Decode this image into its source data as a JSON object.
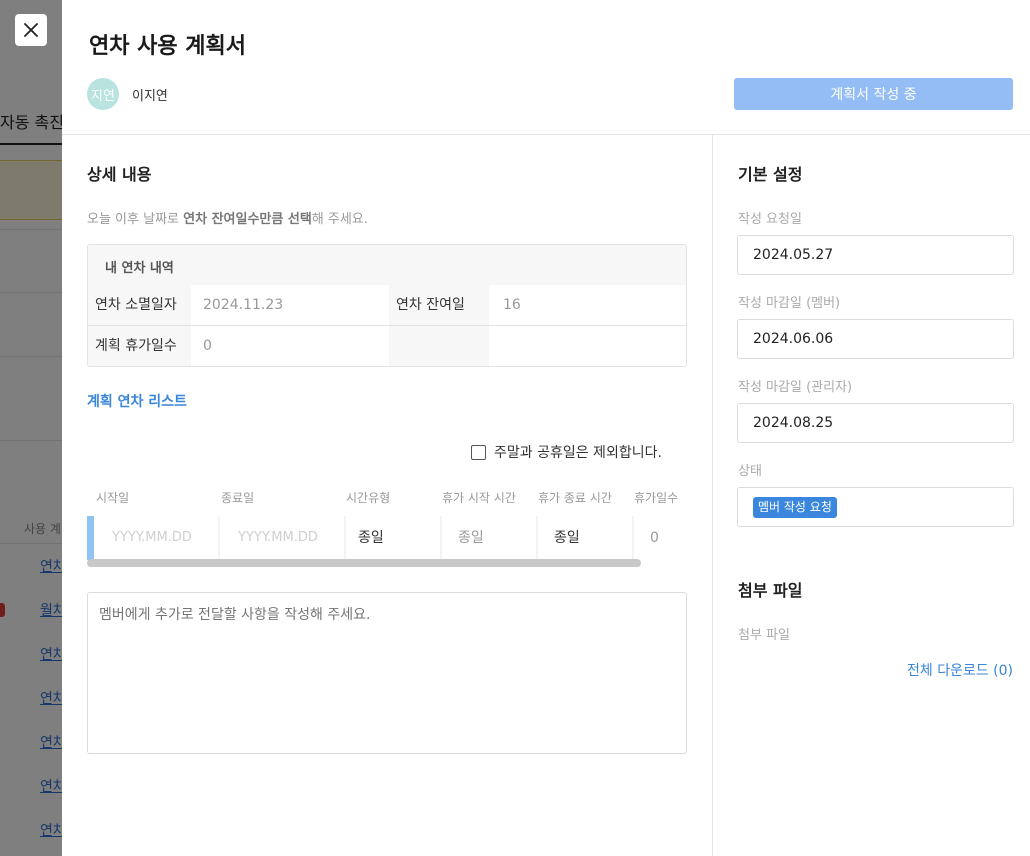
{
  "background": {
    "tab_label": "자동 촉진",
    "list_label": "사용 계",
    "links": [
      "연차",
      "월차",
      "연차",
      "연차",
      "연차",
      "연차",
      "연차"
    ]
  },
  "drawer": {
    "title": "연차 사용 계획서",
    "avatar_text": "지연",
    "author": "이지연",
    "status_button": "계획서 작성 중"
  },
  "detail": {
    "section_title": "상세 내용",
    "hint_prefix": "오늘 이후 날짜로 ",
    "hint_bold": "연차 잔여일수만큼 선택",
    "hint_suffix": "해 주세요.",
    "summary_title": "내 연차 내역",
    "expire_label": "연차 소멸일자",
    "expire_value": "2024.11.23",
    "remain_label": "연차 잔여일",
    "remain_value": "16",
    "planned_label": "계획 휴가일수",
    "planned_value": "0",
    "list_title": "계획 연차 리스트",
    "exclude_label": "주말과 공휴일은 제외합니다.",
    "exclude_checked": false,
    "columns": [
      "시작일",
      "종료일",
      "시간유형",
      "휴가 시작 시간",
      "휴가 종료 시간",
      "휴가일수"
    ],
    "row": {
      "start_placeholder": "YYYY.MM.DD",
      "end_placeholder": "YYYY.MM.DD",
      "time_type": "종일",
      "start_time": "종일",
      "end_time": "종일",
      "days": "0"
    },
    "memo_placeholder": "멤버에게 추가로 전달할 사항을 작성해 주세요."
  },
  "settings": {
    "section_title": "기본 설정",
    "request_date_label": "작성 요청일",
    "request_date": "2024.05.27",
    "member_deadline_label": "작성 마감일 (멤버)",
    "member_deadline": "2024.06.06",
    "admin_deadline_label": "작성 마감일 (관리자)",
    "admin_deadline": "2024.08.25",
    "status_label": "상태",
    "status_badge": "멤버 작성 요청",
    "attach_title": "첨부 파일",
    "attach_label": "첨부 파일",
    "download_all": "전체 다운로드 (0)"
  },
  "colors": {
    "accent": "#3b87dd",
    "status_button_bg": "#94bdf5",
    "avatar_bg": "#b8e3de",
    "row_marker": "#8fc3f4"
  }
}
